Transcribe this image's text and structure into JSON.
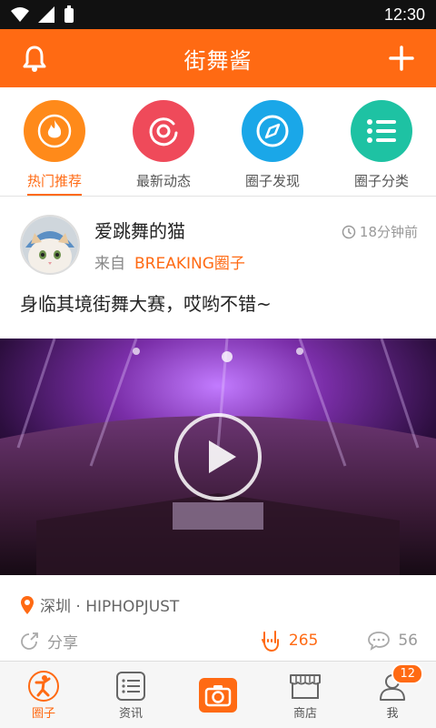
{
  "statusbar": {
    "time": "12:30"
  },
  "appbar": {
    "title": "街舞酱"
  },
  "categories": [
    {
      "label": "热门推荐",
      "color": "#ff8a1a",
      "icon": "flame-icon",
      "active": true
    },
    {
      "label": "最新动态",
      "color": "#ef4a5a",
      "icon": "refresh-icon",
      "active": false
    },
    {
      "label": "圈子发现",
      "color": "#1aa7e8",
      "icon": "compass-icon",
      "active": false
    },
    {
      "label": "圈子分类",
      "color": "#1ec2a3",
      "icon": "list-icon",
      "active": false
    }
  ],
  "post": {
    "user": "爱跳舞的猫",
    "time": "18分钟前",
    "from_prefix": "来自",
    "group": "BREAKING圈子",
    "text": "身临其境街舞大赛，哎哟不错~",
    "location": "深圳 · HIPHOPJUST",
    "share_label": "分享",
    "likes": "265",
    "comments": "56"
  },
  "tabs": [
    {
      "label": "圈子",
      "icon": "dancer-icon",
      "active": true
    },
    {
      "label": "资讯",
      "icon": "news-icon",
      "active": false
    },
    {
      "label": "",
      "icon": "camera-icon",
      "active": false
    },
    {
      "label": "商店",
      "icon": "shop-icon",
      "active": false
    },
    {
      "label": "我",
      "icon": "user-icon",
      "active": false,
      "badge": "12"
    }
  ],
  "accent": "#ff6a13"
}
